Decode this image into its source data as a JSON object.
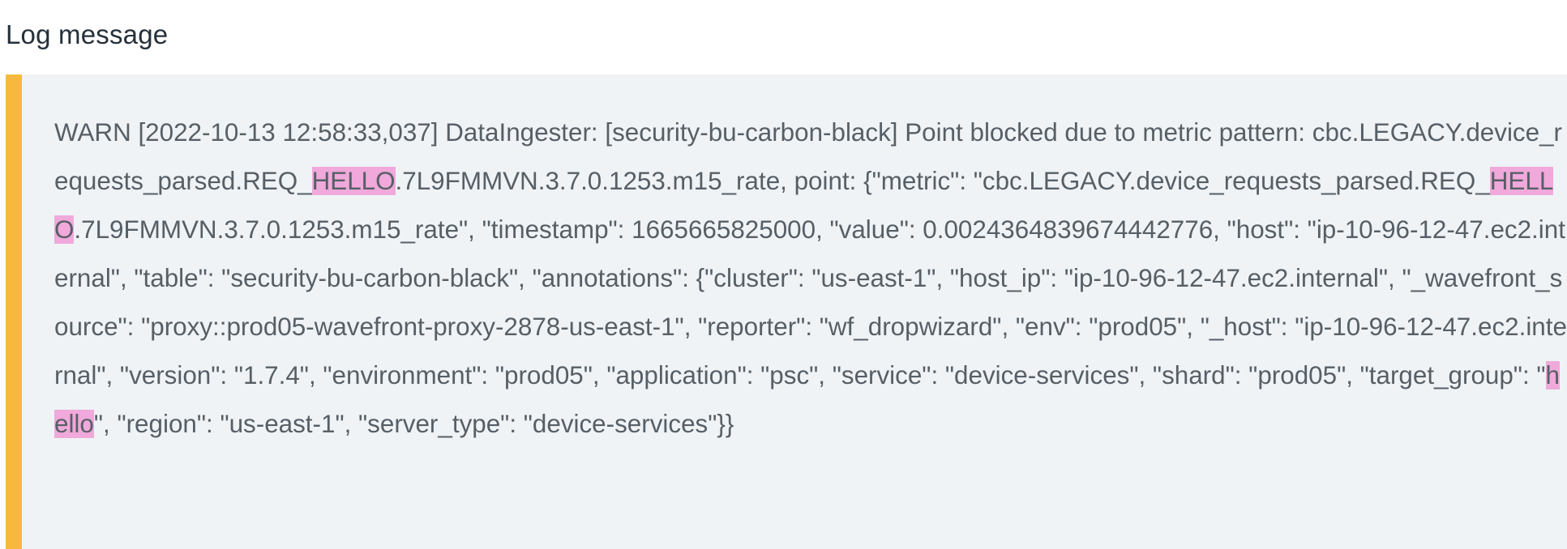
{
  "section": {
    "title": "Log message"
  },
  "colors": {
    "accent": "#f6b93d",
    "box_background": "#eff3f6",
    "highlight": "#f0a9da",
    "text": "#575f66"
  },
  "log": {
    "segments": [
      {
        "text": "WARN [2022-10-13 12:58:33,037] DataIngester: [security-bu-carbon-black] Point blocked due to metric pattern: cbc.LEGACY.device_requests_parsed.REQ_",
        "highlight": false
      },
      {
        "text": "HELLO",
        "highlight": true
      },
      {
        "text": ".7L9FMMVN.3.7.0.1253.m15_rate, point: {\"metric\": \"cbc.LEGACY.device_requests_parsed.REQ_",
        "highlight": false
      },
      {
        "text": "HELLO",
        "highlight": true
      },
      {
        "text": ".7L9FMMVN.3.7.0.1253.m15_rate\", \"timestamp\": 1665665825000, \"value\": 0.0024364839674442776, \"host\": \"ip-10-96-12-47.ec2.internal\", \"table\": \"security-bu-carbon-black\", \"annotations\": {\"cluster\": \"us-east-1\", \"host_ip\": \"ip-10-96-12-47.ec2.internal\", \"_wavefront_source\": \"proxy::prod05-wavefront-proxy-2878-us-east-1\", \"reporter\": \"wf_dropwizard\", \"env\": \"prod05\", \"_host\": \"ip-10-96-12-47.ec2.internal\", \"version\": \"1.7.4\", \"environment\": \"prod05\", \"application\": \"psc\", \"service\": \"device-services\", \"shard\": \"prod05\", \"target_group\": \"",
        "highlight": false
      },
      {
        "text": "hello",
        "highlight": true
      },
      {
        "text": "\", \"region\": \"us-east-1\", \"server_type\": \"device-services\"}}",
        "highlight": false
      }
    ]
  }
}
